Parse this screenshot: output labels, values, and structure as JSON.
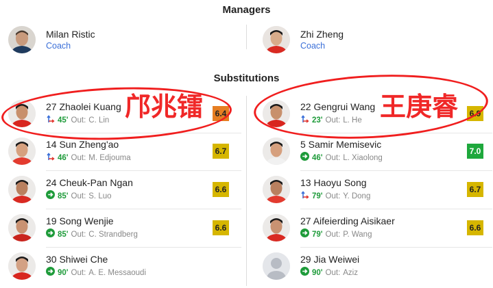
{
  "managers": {
    "title": "Managers",
    "home": {
      "name": "Milan Ristic",
      "role": "Coach"
    },
    "away": {
      "name": "Zhi Zheng",
      "role": "Coach"
    }
  },
  "substitutions": {
    "title": "Substitutions",
    "out_label": "Out:",
    "home": [
      {
        "number_name": "27 Zhaolei Kuang",
        "minute": "45'",
        "out": "C. Lin",
        "rating": "6.4",
        "rating_color": "#e67e22",
        "icon": "swap-icon"
      },
      {
        "number_name": "14 Sun Zheng'ao",
        "minute": "46'",
        "out": "M. Edjouma",
        "rating": "6.7",
        "rating_color": "#d6b600",
        "icon": "swap-icon"
      },
      {
        "number_name": "24 Cheuk-Pan Ngan",
        "minute": "85'",
        "out": "S. Luo",
        "rating": "6.6",
        "rating_color": "#d6b600",
        "icon": "sub-in-arrow-icon"
      },
      {
        "number_name": "19 Song Wenjie",
        "minute": "85'",
        "out": "C. Strandberg",
        "rating": "6.6",
        "rating_color": "#d6b600",
        "icon": "sub-in-arrow-icon"
      },
      {
        "number_name": "30 Shiwei Che",
        "minute": "90'",
        "out": "A. E. Messaoudi",
        "rating": "",
        "rating_color": "",
        "icon": "sub-in-arrow-icon"
      }
    ],
    "away": [
      {
        "number_name": "22 Gengrui Wang",
        "minute": "23'",
        "out": "L. He",
        "rating": "6.9",
        "rating_color": "#d6b600",
        "icon": "swap-icon"
      },
      {
        "number_name": "5 Samir Memisevic",
        "minute": "46'",
        "out": "L. Xiaolong",
        "rating": "7.0",
        "rating_color": "#1ea83c",
        "icon": "sub-in-arrow-icon"
      },
      {
        "number_name": "13 Haoyu Song",
        "minute": "79'",
        "out": "Y. Dong",
        "rating": "6.7",
        "rating_color": "#d6b600",
        "icon": "swap-icon"
      },
      {
        "number_name": "27 Aifeierding Aisikaer",
        "minute": "79'",
        "out": "P. Wang",
        "rating": "6.6",
        "rating_color": "#d6b600",
        "icon": "sub-in-arrow-icon"
      },
      {
        "number_name": "29 Jia Weiwei",
        "minute": "90'",
        "out": "Aziz",
        "rating": "",
        "rating_color": "",
        "icon": "sub-in-arrow-icon"
      }
    ]
  },
  "annotations": {
    "home_chinese_name": "邝兆镭",
    "away_chinese_name": "王庚睿",
    "highlight_color": "#f01e1e"
  },
  "colors": {
    "accent_blue": "#3a6fd8",
    "sub_green": "#1e9b3a",
    "swap_blue": "#3a6fd8",
    "swap_red": "#e0302a"
  }
}
